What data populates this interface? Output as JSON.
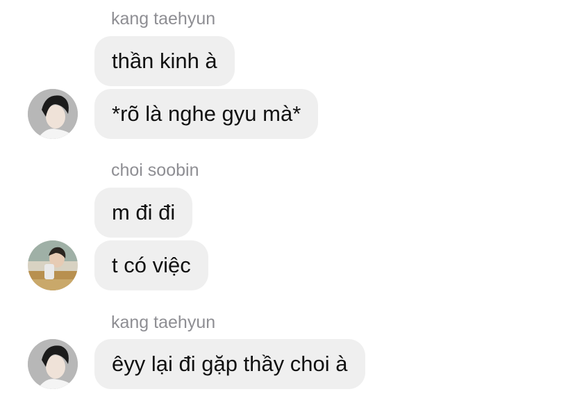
{
  "groups": [
    {
      "sender": "kang taehyun",
      "avatar_icon": "kang-taehyun-avatar",
      "messages": [
        "thần kinh à",
        "*rõ là nghe gyu mà*"
      ]
    },
    {
      "sender": "choi soobin",
      "avatar_icon": "choi-soobin-avatar",
      "messages": [
        "m đi đi",
        "t có việc"
      ]
    },
    {
      "sender": "kang taehyun",
      "avatar_icon": "kang-taehyun-avatar",
      "messages": [
        "êyy lại đi gặp thầy choi à"
      ]
    }
  ],
  "colors": {
    "bubble": "#efefef",
    "sender_text": "#8e8e93",
    "message_text": "#111111",
    "background": "#ffffff"
  }
}
